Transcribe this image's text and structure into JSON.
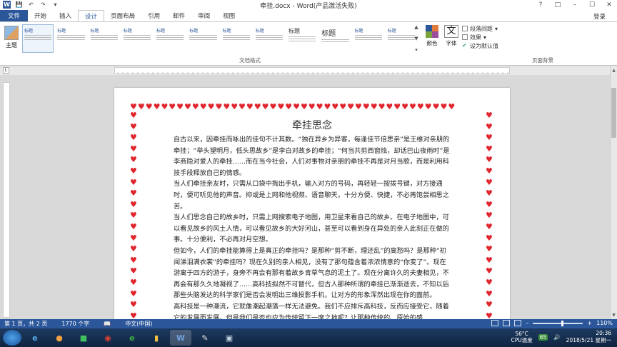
{
  "title_bar": {
    "document_title": "牵挂.docx - Word(产品激活失败)"
  },
  "tabs": [
    "文件",
    "开始",
    "插入",
    "设计",
    "页面布局",
    "引用",
    "邮件",
    "审阅",
    "视图"
  ],
  "active_tab": "设计",
  "login_label": "登录",
  "ribbon": {
    "theme_label": "主题",
    "style_thumbs": [
      "标题",
      "标题",
      "标题",
      "标题",
      "标题",
      "标题",
      "标题",
      "标题",
      "标题",
      "标题",
      "标题",
      "标题"
    ],
    "doc_format_group_label": "文档格式",
    "colors_label": "颜色",
    "fonts_label": "字体",
    "fonts_glyph": "文",
    "paragraph_spacing": "段落间距",
    "effects": "效果",
    "set_default": "设为默认值",
    "page_bg_group_label": "页面背景"
  },
  "document": {
    "heading": "牵挂思念",
    "paragraphs": [
      "自古以来，因牵挂而咏出的佳句不计其数。“独在异乡为异客，每逢佳节倍思亲”是王维对亲朋的牵挂；“举头望明月，低头思故乡”是李白对故乡的牵挂；“何当共剪西窗烛，却话巴山夜雨时”是李商隐对爱人的牵挂……而在当今社会，人们对事物对亲朋的牵挂不再是对月当歌，而是利用科技手段释放自己的情感。",
      "当人们牵挂亲友时，只需从口袋中掏出手机，输入对方的号码，再轻轻一按拨号键，对方接通时，便可听见他的声音。抑或是上网和他视频、语音聊天，十分方便、快捷，不必再饱尝相思之苦。",
      "当人们思念自己的故乡时，只需上网搜索电子地图，用卫星来看自己的故乡。在电子地图中，可以看见故乡的风土人情，可以看见故乡的大好河山，甚至可以看到身在异处的亲人此刻正在做的事。十分便利，不必再对月空想。",
      "但如今，人们的牵挂能算得上是真正的牵挂吗？是那种“剪不断，理还乱”的离愁吗？是那种“初闻涕泪满衣裳”的牵挂吗？现在久别的亲人相见，没有了那句蕴含着浓浓情意的“你变了”。现在游离于四方的游子，身旁不再会有那有着故乡青草气息的泥土了。现在分离许久的夫妻相见，不再会有那久久地凝视了……高科技拟然不可替代，但古人那种所谓的牵挂已渐渐逝去，不知以后那些头脑发达的科学家们是否会发明出三维投影手机，让对方的形象浑然出现在你的面前。",
      "高科技是一种潮流，它就像潮起潮落一样无法避免。我们不应排斥高科技，反而应接受它，随着它的发展而发展。但是我们是否也应为传统留下一席之地呢？让那种传统的、原始的感"
    ]
  },
  "status_bar": {
    "page": "第 1 页，共 2 页",
    "words": "1770 个字",
    "language": "中文(中国)",
    "zoom": "110%"
  },
  "taskbar": {
    "word_label": "W",
    "temperature": "56°C",
    "cpu_label": "CPU温度",
    "badge": "65",
    "time": "20:36",
    "date": "2018/5/21 星期一"
  },
  "colors": {
    "accent": "#2b579a",
    "heart": "#e0262d"
  }
}
